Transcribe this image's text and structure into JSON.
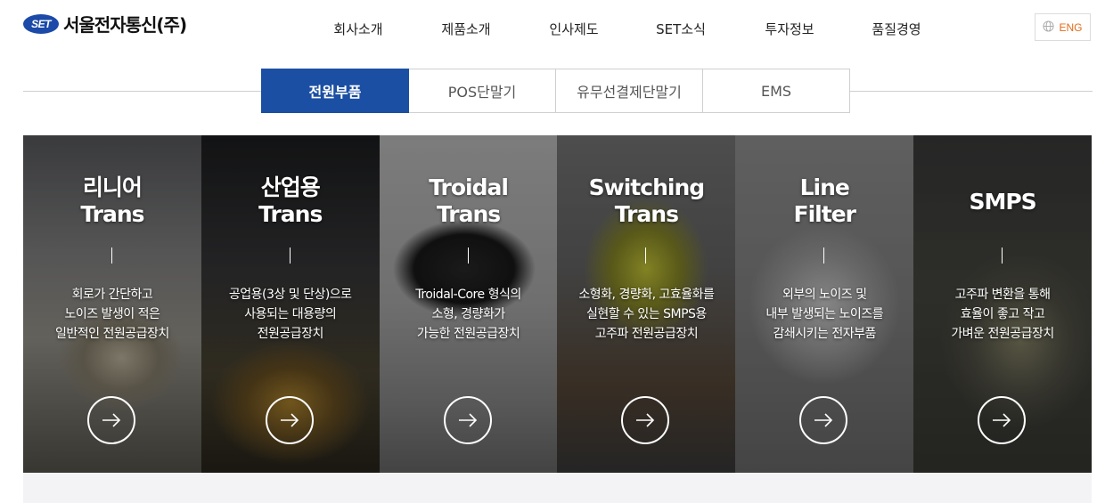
{
  "header": {
    "logo_badge": "SET",
    "logo_text": "서울전자통신(주)",
    "nav": [
      {
        "label": "회사소개"
      },
      {
        "label": "제품소개"
      },
      {
        "label": "인사제도"
      },
      {
        "label": "SET소식"
      },
      {
        "label": "투자정보"
      },
      {
        "label": "품질경영"
      }
    ],
    "lang": {
      "label": "ENG",
      "icon": "globe-icon"
    }
  },
  "tabs": [
    {
      "label": "전원부품",
      "active": true
    },
    {
      "label": "POS단말기",
      "active": false
    },
    {
      "label": "유무선결제단말기",
      "active": false
    },
    {
      "label": "EMS",
      "active": false
    }
  ],
  "products": [
    {
      "title": [
        "리니어",
        "Trans"
      ],
      "desc": [
        "회로가 간단하고",
        "노이즈 발생이 적은",
        "일반적인 전원공급장치"
      ],
      "icon": "arrow-right-icon"
    },
    {
      "title": [
        "산업용",
        "Trans"
      ],
      "desc": [
        "공업용(3상 및 단상)으로",
        "사용되는 대용량의",
        "전원공급장치"
      ],
      "icon": "arrow-right-icon"
    },
    {
      "title": [
        "Troidal",
        "Trans"
      ],
      "desc": [
        "Troidal-Core 형식의",
        "소형, 경량화가",
        "가능한 전원공급장치"
      ],
      "icon": "arrow-right-icon"
    },
    {
      "title": [
        "Switching",
        "Trans"
      ],
      "desc": [
        "소형화, 경량화, 고효율화를",
        "실현할 수 있는 SMPS용",
        "고주파 전원공급장치"
      ],
      "icon": "arrow-right-icon"
    },
    {
      "title": [
        "Line",
        "Filter"
      ],
      "desc": [
        "외부의 노이즈 및",
        "내부 발생되는 노이즈를",
        "감쇄시키는 전자부품"
      ],
      "icon": "arrow-right-icon"
    },
    {
      "title": [
        "SMPS"
      ],
      "desc": [
        "고주파 변환을 통해",
        "효율이 좋고 작고",
        "가벼운 전원공급장치"
      ],
      "icon": "arrow-right-icon"
    }
  ],
  "colors": {
    "brand_blue": "#1b4fa3",
    "lang_orange": "#e36b19"
  }
}
